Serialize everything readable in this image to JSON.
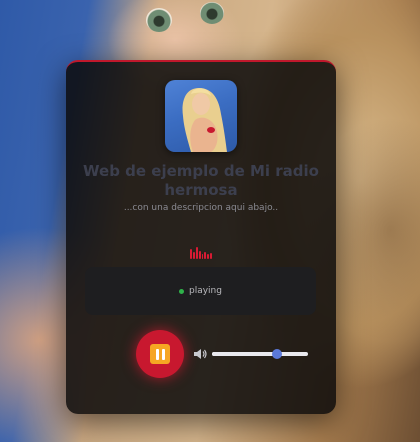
{
  "station": {
    "title": "Web de ejemplo de Mi radio hermosa",
    "description": "...con una descripcion aqui abajo.."
  },
  "player": {
    "status": "playing",
    "state_icon": "pause-icon",
    "volume": 0.68
  },
  "colors": {
    "accent": "#c8182f",
    "status_dot": "#2fb24a",
    "slider_thumb": "#5b79d9",
    "pause_badge": "#f6a623"
  },
  "equalizer": [
    0.85,
    0.55,
    1.0,
    0.7,
    0.45,
    0.6,
    0.4,
    0.5
  ]
}
